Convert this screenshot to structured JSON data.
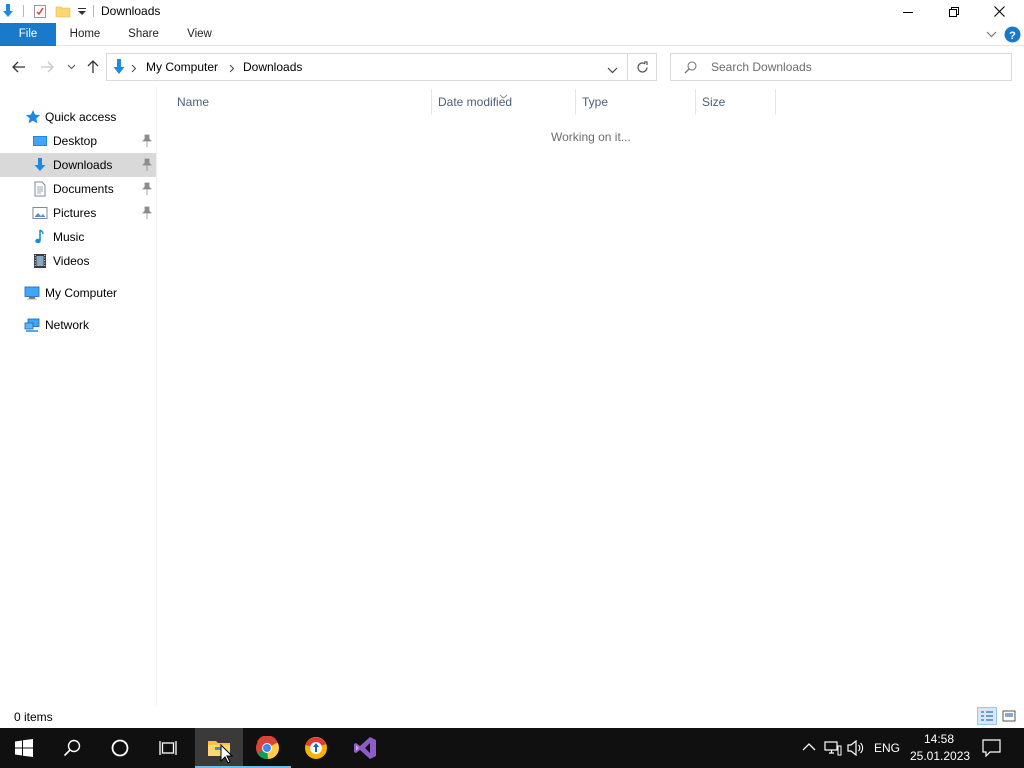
{
  "window": {
    "title": "Downloads"
  },
  "ribbon": {
    "tabs": [
      {
        "label": "File"
      },
      {
        "label": "Home"
      },
      {
        "label": "Share"
      },
      {
        "label": "View"
      }
    ]
  },
  "address": {
    "breadcrumbs": [
      "My Computer",
      "Downloads"
    ],
    "search_placeholder": "Search Downloads"
  },
  "sidebar": {
    "quick_access": "Quick access",
    "items": [
      {
        "label": "Desktop",
        "icon": "desktop-icon",
        "pinned": true
      },
      {
        "label": "Downloads",
        "icon": "downloads-icon",
        "pinned": true,
        "selected": true
      },
      {
        "label": "Documents",
        "icon": "documents-icon",
        "pinned": true
      },
      {
        "label": "Pictures",
        "icon": "pictures-icon",
        "pinned": true
      },
      {
        "label": "Music",
        "icon": "music-icon",
        "pinned": false
      },
      {
        "label": "Videos",
        "icon": "videos-icon",
        "pinned": false
      }
    ],
    "my_computer": "My Computer",
    "network": "Network"
  },
  "content": {
    "columns": [
      "Name",
      "Date modified",
      "Type",
      "Size"
    ],
    "sorted_column": "Date modified",
    "status_message": "Working on it..."
  },
  "statusbar": {
    "item_count": "0 items"
  },
  "taskbar": {
    "apps": [
      "start-icon",
      "search-icon",
      "cortana-icon",
      "task-view-icon",
      "file-explorer-icon",
      "chrome-icon",
      "browser-icon",
      "visual-studio-icon"
    ],
    "active_app": "file-explorer-icon",
    "language": "ENG",
    "time": "14:58",
    "date": "25.01.2023"
  },
  "colors": {
    "accent": "#1979ca",
    "selected": "#d9d9d9",
    "taskbar": "#101010"
  }
}
